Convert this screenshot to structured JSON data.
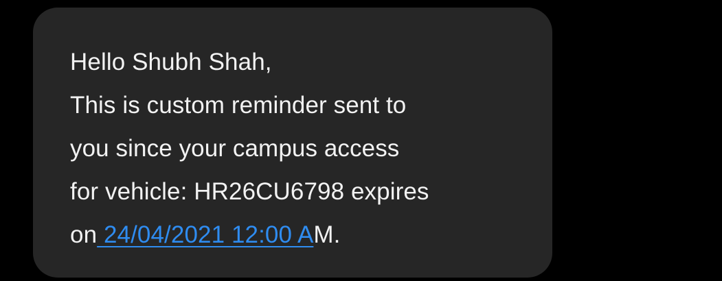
{
  "message": {
    "greeting": "Hello Shubh Shah,",
    "line2": "This is custom reminder sent to",
    "line3": "you since your campus access",
    "line4": "for vehicle: HR26CU6798 expires",
    "line5_prefix": "on",
    "line5_link": " 24/04/2021 12:00 A",
    "line5_suffix": "M."
  },
  "colors": {
    "background": "#000000",
    "bubble": "#262626",
    "text": "#f2f2f2",
    "link": "#2f8cf0"
  }
}
